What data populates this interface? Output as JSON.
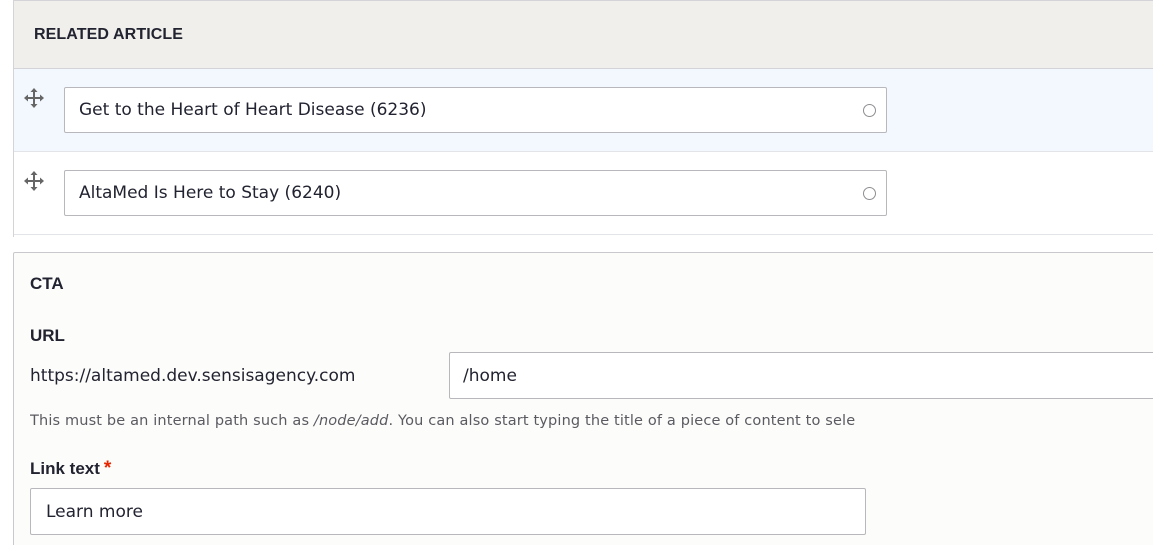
{
  "related_article": {
    "header": "RELATED ARTICLE",
    "rows": [
      {
        "value": "Get to the Heart of Heart Disease (6236)"
      },
      {
        "value": "AltaMed Is Here to Stay (6240)"
      }
    ]
  },
  "cta": {
    "title": "CTA",
    "url_label": "URL",
    "url_prefix": "https://altamed.dev.sensisagency.com",
    "url_value": "/home",
    "description_before": "This must be an internal path such as ",
    "description_example": "/node/add",
    "description_after": ". You can also start typing the title of a piece of content to sele",
    "link_text_label": "Link text",
    "required_marker": "*",
    "link_text_value": "Learn more"
  },
  "icons": {
    "drag_handle": "drag-handle-icon",
    "autocomplete": "autocomplete-throbber-icon"
  },
  "colors": {
    "header_bg": "#f0efec",
    "row_highlight_bg": "#f2f8fd",
    "required": "#e62600",
    "border": "#b8b8bc"
  }
}
